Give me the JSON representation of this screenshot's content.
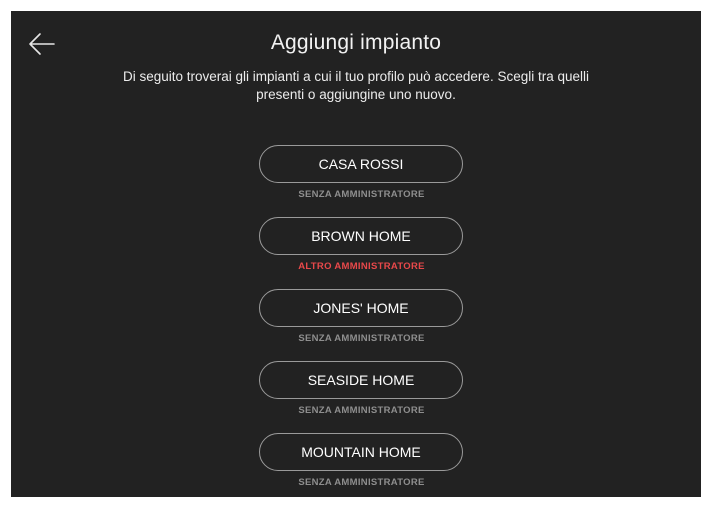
{
  "header": {
    "back_icon": "arrow-left-icon",
    "title": "Aggiungi impianto",
    "subtitle_line1": "Di seguito troverai gli impianti a cui il tuo profilo può accedere. Scegli tra quelli",
    "subtitle_line2": "presenti o aggiungine uno nuovo."
  },
  "colors": {
    "background": "#222222",
    "button_border": "#9a9a9a",
    "status_default": "#8e8e8e",
    "status_alert": "#e8484a"
  },
  "plants": [
    {
      "name": "CASA ROSSI",
      "status": "SENZA AMMINISTRATORE"
    },
    {
      "name": "BROWN HOME",
      "status": "ALTRO AMMINISTRATORE"
    },
    {
      "name": "JONES' HOME",
      "status": "SENZA AMMINISTRATORE"
    },
    {
      "name": "SEASIDE HOME",
      "status": "SENZA AMMINISTRATORE"
    },
    {
      "name": "MOUNTAIN HOME",
      "status": "SENZA AMMINISTRATORE"
    }
  ]
}
